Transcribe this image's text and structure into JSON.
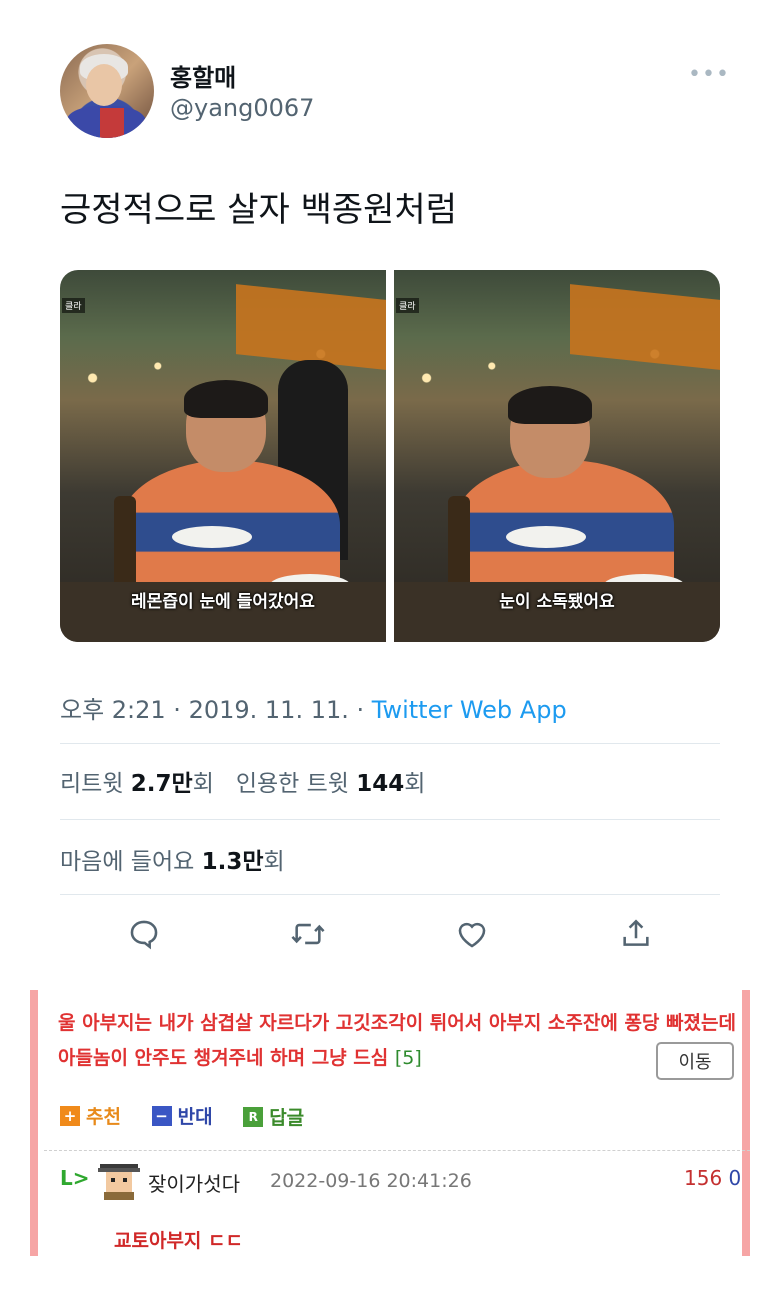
{
  "tweet": {
    "display_name": "홍할매",
    "handle": "@yang0067",
    "more": "•••",
    "text": "긍정적으로 살자 백종원처럼",
    "media": [
      {
        "caption": "레몬즙이 눈에 들어갔어요",
        "tag": "클라"
      },
      {
        "caption": "눈이 소독됐어요",
        "tag": "클라"
      }
    ],
    "time": "오후 2:21 · 2019. 11. 11. · ",
    "app": "Twitter Web App",
    "retweets_label": "리트윗 ",
    "retweets_value": "2.7만",
    "retweets_unit": "회",
    "quotes_label": "인용한 트윗 ",
    "quotes_value": "144",
    "quotes_unit": "회",
    "likes_label": "마음에 들어요 ",
    "likes_value": "1.3만",
    "likes_unit": "회",
    "actions": [
      "reply-icon",
      "retweet-icon",
      "like-icon",
      "share-icon"
    ],
    "accent": "#1d9bf0"
  },
  "comment": {
    "text": "울 아부지는 내가 삼겹살 자르다가 고깃조각이 튀어서 아부지 소주잔에 퐁당 빠졌는데 아들놈이 안주도 챙겨주네 하며 그냥 드심 ",
    "reply_count": "[5]",
    "move_label": "이동",
    "recommend_label": "추천",
    "oppose_label": "반대",
    "reply_label": "답글",
    "recommend_icon": "+",
    "oppose_icon": "−",
    "reply_icon": "R",
    "border_color": "#f6a5a5"
  },
  "reply": {
    "arrow": "L>",
    "name": "잦이가섯다",
    "time": "2022-09-16 20:41:26",
    "score_up": "156",
    "score_down": "0",
    "text": "교토아부지 ㄷㄷ"
  }
}
